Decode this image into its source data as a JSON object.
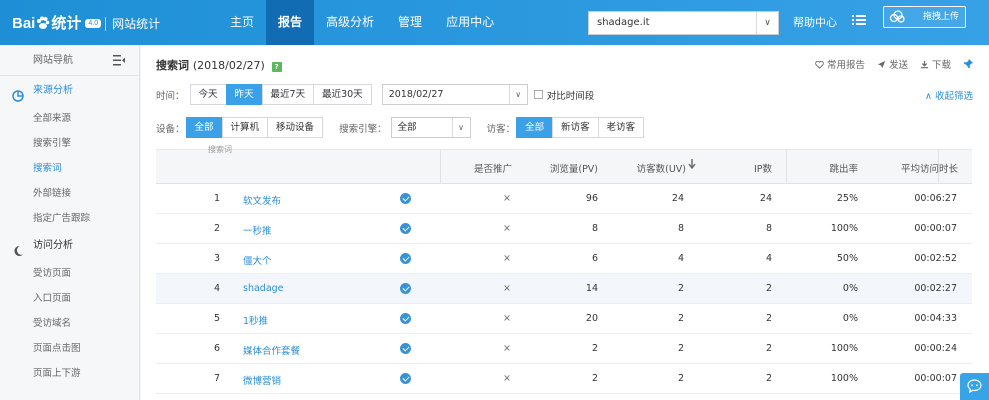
{
  "header": {
    "logo_text": "Bai",
    "logo_text2": "统计",
    "logo_version": "4.0",
    "logo_site": "网站统计",
    "nav": [
      "主页",
      "报告",
      "高级分析",
      "管理",
      "应用中心"
    ],
    "active_nav": 1,
    "site_value": "shadage.it",
    "help_label": "帮助中心",
    "upload_label": "拖拽上传"
  },
  "sidebar": {
    "header": "网站导航",
    "groups": [
      {
        "label": "来源分析",
        "icon": "pie-chart-icon",
        "active": true,
        "items": [
          "全部来源",
          "搜索引擎",
          "搜索词",
          "外部链接",
          "指定广告跟踪"
        ],
        "active_item": 2
      },
      {
        "label": "访问分析",
        "icon": "moon-icon",
        "active": false,
        "items": [
          "受访页面",
          "入口页面",
          "受访域名",
          "页面点击图",
          "页面上下游"
        ],
        "active_item": -1
      }
    ]
  },
  "report": {
    "title": "搜索词",
    "date_label": "(2018/02/27)",
    "actions": [
      "常用报告",
      "发送",
      "下载"
    ],
    "time_label": "时间：",
    "time_buttons": [
      "今天",
      "昨天",
      "最近7天",
      "最近30天"
    ],
    "time_active": 1,
    "date_value": "2018/02/27",
    "compare_label": "对比时间段",
    "collapse_label": "收起筛选",
    "device_label": "设备：",
    "device_buttons": [
      "全部",
      "计算机",
      "移动设备"
    ],
    "device_active": 0,
    "engine_label": "搜索引擎：",
    "engine_value": "全部",
    "visitor_label": "访客：",
    "visitor_buttons": [
      "全部",
      "新访客",
      "老访客"
    ],
    "visitor_active": 0
  },
  "table": {
    "kw_header": "搜索词",
    "columns": [
      "是否推广",
      "浏览量(PV)",
      "访客数(UV)",
      "IP数",
      "跳出率",
      "平均访问时长"
    ],
    "rows": [
      {
        "n": "1",
        "kw": "软文发布",
        "promo": "×",
        "pv": "96",
        "uv": "24",
        "ip": "24",
        "bounce": "25%",
        "dur": "00:06:27"
      },
      {
        "n": "2",
        "kw": "一秒推",
        "promo": "×",
        "pv": "8",
        "uv": "8",
        "ip": "8",
        "bounce": "100%",
        "dur": "00:00:07"
      },
      {
        "n": "3",
        "kw": "僵大个",
        "promo": "×",
        "pv": "6",
        "uv": "4",
        "ip": "4",
        "bounce": "50%",
        "dur": "00:02:52"
      },
      {
        "n": "4",
        "kw": "shadage",
        "promo": "×",
        "pv": "14",
        "uv": "2",
        "ip": "2",
        "bounce": "0%",
        "dur": "00:02:27"
      },
      {
        "n": "5",
        "kw": "1秒推",
        "promo": "×",
        "pv": "20",
        "uv": "2",
        "ip": "2",
        "bounce": "0%",
        "dur": "00:04:33"
      },
      {
        "n": "6",
        "kw": "媒体合作套餐",
        "promo": "×",
        "pv": "2",
        "uv": "2",
        "ip": "2",
        "bounce": "100%",
        "dur": "00:00:24"
      },
      {
        "n": "7",
        "kw": "微博营销",
        "promo": "×",
        "pv": "2",
        "uv": "2",
        "ip": "2",
        "bounce": "100%",
        "dur": "00:00:07"
      }
    ],
    "highlight_row": 3
  }
}
